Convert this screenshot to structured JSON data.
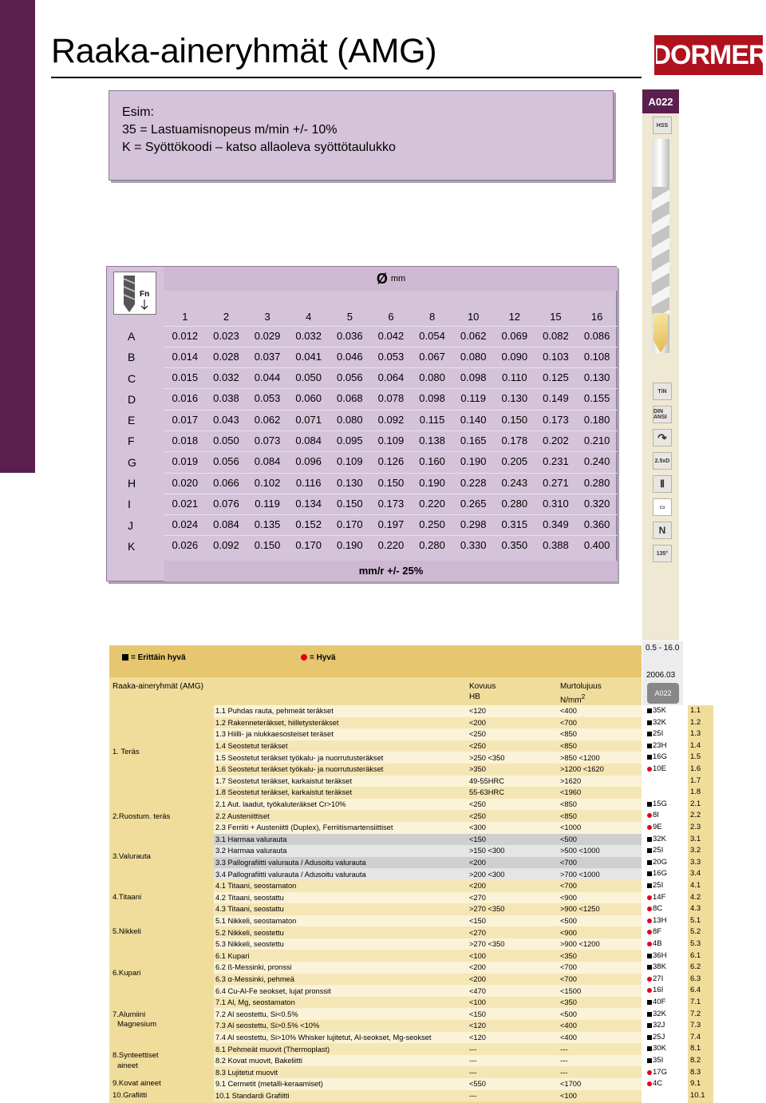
{
  "title": "Raaka-aineryhmät (AMG)",
  "brand": "DORMER",
  "product_code": "A022",
  "example": {
    "line1": "Esim:",
    "line2": "35 = Lastuamisnopeus m/min +/- 10%",
    "line3": "K = Syöttökoodi – katso allaoleva syöttötaulukko"
  },
  "side_icons": [
    "HSS",
    "TiN",
    "DIN ANSI",
    "2.5xD",
    "N",
    "135°"
  ],
  "feed_table": {
    "diameter_symbol": "Ø",
    "diameter_unit": "mm",
    "unit_label": "mm/r +/- 25%",
    "diameters": [
      "1",
      "2",
      "3",
      "4",
      "5",
      "6",
      "8",
      "10",
      "12",
      "15",
      "16"
    ],
    "rows": [
      {
        "code": "A",
        "values": [
          "0.012",
          "0.023",
          "0.029",
          "0.032",
          "0.036",
          "0.042",
          "0.054",
          "0.062",
          "0.069",
          "0.082",
          "0.086"
        ]
      },
      {
        "code": "B",
        "values": [
          "0.014",
          "0.028",
          "0.037",
          "0.041",
          "0.046",
          "0.053",
          "0.067",
          "0.080",
          "0.090",
          "0.103",
          "0.108"
        ]
      },
      {
        "code": "C",
        "values": [
          "0.015",
          "0.032",
          "0.044",
          "0.050",
          "0.056",
          "0.064",
          "0.080",
          "0.098",
          "0.110",
          "0.125",
          "0.130"
        ]
      },
      {
        "code": "D",
        "values": [
          "0.016",
          "0.038",
          "0.053",
          "0.060",
          "0.068",
          "0.078",
          "0.098",
          "0.119",
          "0.130",
          "0.149",
          "0.155"
        ]
      },
      {
        "code": "E",
        "values": [
          "0.017",
          "0.043",
          "0.062",
          "0.071",
          "0.080",
          "0.092",
          "0.115",
          "0.140",
          "0.150",
          "0.173",
          "0.180"
        ]
      },
      {
        "code": "F",
        "values": [
          "0.018",
          "0.050",
          "0.073",
          "0.084",
          "0.095",
          "0.109",
          "0.138",
          "0.165",
          "0.178",
          "0.202",
          "0.210"
        ]
      },
      {
        "code": "G",
        "values": [
          "0.019",
          "0.056",
          "0.084",
          "0.096",
          "0.109",
          "0.126",
          "0.160",
          "0.190",
          "0.205",
          "0.231",
          "0.240"
        ]
      },
      {
        "code": "H",
        "values": [
          "0.020",
          "0.066",
          "0.102",
          "0.116",
          "0.130",
          "0.150",
          "0.190",
          "0.228",
          "0.243",
          "0.271",
          "0.280"
        ]
      },
      {
        "code": "I",
        "values": [
          "0.021",
          "0.076",
          "0.119",
          "0.134",
          "0.150",
          "0.173",
          "0.220",
          "0.265",
          "0.280",
          "0.310",
          "0.320"
        ]
      },
      {
        "code": "J",
        "values": [
          "0.024",
          "0.084",
          "0.135",
          "0.152",
          "0.170",
          "0.197",
          "0.250",
          "0.298",
          "0.315",
          "0.349",
          "0.360"
        ]
      },
      {
        "code": "K",
        "values": [
          "0.026",
          "0.092",
          "0.150",
          "0.170",
          "0.190",
          "0.220",
          "0.280",
          "0.330",
          "0.350",
          "0.388",
          "0.400"
        ]
      }
    ]
  },
  "legend": {
    "very_good": "= Erittäin hyvä",
    "good": "= Hyvä"
  },
  "right_panel": {
    "range": "0.5 - 16.0",
    "date": "2006.03",
    "pic_label": "A022"
  },
  "materials_header": {
    "group": "Raaka-aineryhmät (AMG)",
    "hardness": "Kovuus",
    "hardness_unit": "HB",
    "strength": "Murtolujuus",
    "strength_unit": "N/mm",
    "strength_exp": "2"
  },
  "groups": [
    "1. Teräs",
    "2.Ruostum. teräs",
    "3.Valurauta",
    "4.Titaani",
    "5.Nikkeli",
    "6.Kupari",
    "7.Alumiini",
    "Magnesium",
    "8.Synteettiset",
    "aineet",
    "9.Kovat aineet",
    "10.Grafiitti"
  ],
  "materials": [
    {
      "name": "1.1 Puhdas rauta, pehmeät teräkset",
      "hb": "<120",
      "nmm": "<400",
      "mark": "sq",
      "code": "35K",
      "num": "1.1"
    },
    {
      "name": "1.2 Rakenneteräkset, hiilletysteräkset",
      "hb": "<200",
      "nmm": "<700",
      "mark": "sq",
      "code": "32K",
      "num": "1.2"
    },
    {
      "name": "1.3 Hiilli- ja niukkaesosteiset teräset",
      "hb": "<250",
      "nmm": "<850",
      "mark": "sq",
      "code": "25I",
      "num": "1.3"
    },
    {
      "name": "1.4 Seostetut teräkset",
      "hb": "<250",
      "nmm": "<850",
      "mark": "sq",
      "code": "23H",
      "num": "1.4"
    },
    {
      "name": "1.5 Seostetut teräkset työkalu- ja nuorrutusteräkset",
      "hb": ">250 <350",
      "nmm": ">850   <1200",
      "mark": "sq",
      "code": "16G",
      "num": "1.5"
    },
    {
      "name": "1.6 Seostetut teräkset työkalu- ja nuorrutusteräkset",
      "hb": ">350",
      "nmm": ">1200 <1620",
      "mark": "dot",
      "code": "10E",
      "num": "1.6"
    },
    {
      "name": "1.7 Seostetut teräkset, karkaistut teräkset",
      "hb": "49-55HRC",
      "nmm": ">1620",
      "mark": "",
      "code": "",
      "num": "1.7"
    },
    {
      "name": "1.8 Seostetut teräkset, karkaistut teräkset",
      "hb": "55-63HRC",
      "nmm": "<1960",
      "mark": "",
      "code": "",
      "num": "1.8"
    },
    {
      "name": "2.1 Aut. laadut, työkaluteräkset Cr>10%",
      "hb": "<250",
      "nmm": "<850",
      "mark": "sq",
      "code": "15G",
      "num": "2.1"
    },
    {
      "name": "2.2 Austeniittiset",
      "hb": "<250",
      "nmm": "<850",
      "mark": "dot",
      "code": "8I",
      "num": "2.2"
    },
    {
      "name": "2.3 Ferriiti + Austeniitti (Duplex), Ferriitismartensiittiset",
      "hb": "<300",
      "nmm": "<1000",
      "mark": "dot",
      "code": "9E",
      "num": "2.3"
    },
    {
      "name": "3.1 Harmaa valurauta",
      "hb": "<150",
      "nmm": "<500",
      "mark": "sq",
      "code": "32K",
      "num": "3.1"
    },
    {
      "name": "3.2 Harmaa valurauta",
      "hb": ">150 <300",
      "nmm": ">500 <1000",
      "mark": "sq",
      "code": "25I",
      "num": "3.2"
    },
    {
      "name": "3.3 Pallografiitti valurauta / Adusoitu valurauta",
      "hb": "<200",
      "nmm": "<700",
      "mark": "sq",
      "code": "20G",
      "num": "3.3"
    },
    {
      "name": "3.4 Pallografiitti valurauta / Adusoitu valurauta",
      "hb": ">200 <300",
      "nmm": ">700 <1000",
      "mark": "sq",
      "code": "16G",
      "num": "3.4"
    },
    {
      "name": "4.1 Titaani, seostamaton",
      "hb": "<200",
      "nmm": "<700",
      "mark": "sq",
      "code": "25I",
      "num": "4.1"
    },
    {
      "name": "4.2 Titaani, seostattu",
      "hb": "<270",
      "nmm": "<900",
      "mark": "dot",
      "code": "14F",
      "num": "4.2"
    },
    {
      "name": "4.3 Titaani, seostattu",
      "hb": ">270 <350",
      "nmm": ">900 <1250",
      "mark": "dot",
      "code": "8C",
      "num": "4.3"
    },
    {
      "name": "5.1 Nikkeli, seostamaton",
      "hb": "<150",
      "nmm": "<500",
      "mark": "dot",
      "code": "13H",
      "num": "5.1"
    },
    {
      "name": "5.2 Nikkeli, seostettu",
      "hb": "<270",
      "nmm": "<900",
      "mark": "dot",
      "code": "8F",
      "num": "5.2"
    },
    {
      "name": "5.3 Nikkeli, seostettu",
      "hb": ">270 <350",
      "nmm": ">900 <1200",
      "mark": "dot",
      "code": "4B",
      "num": "5.3"
    },
    {
      "name": "6.1 Kupari",
      "hb": "<100",
      "nmm": "<350",
      "mark": "sq",
      "code": "36H",
      "num": "6.1"
    },
    {
      "name": "6.2 ß-Messinki, pronssi",
      "hb": "<200",
      "nmm": "<700",
      "mark": "sq",
      "code": "38K",
      "num": "6.2"
    },
    {
      "name": "6.3 α-Messinki, pehmeä",
      "hb": "<200",
      "nmm": "<700",
      "mark": "dot",
      "code": "27I",
      "num": "6.3"
    },
    {
      "name": "6.4 Cu-Al-Fe seokset, lujat pronssit",
      "hb": "<470",
      "nmm": "<1500",
      "mark": "dot",
      "code": "16I",
      "num": "6.4"
    },
    {
      "name": "7.1 Al, Mg, seostamaton",
      "hb": "<100",
      "nmm": "<350",
      "mark": "sq",
      "code": "40F",
      "num": "7.1"
    },
    {
      "name": "7.2 Al seostettu, Si<0.5%",
      "hb": "<150",
      "nmm": "<500",
      "mark": "sq",
      "code": "32K",
      "num": "7.2"
    },
    {
      "name": "7.3 Al seostettu, Si>0.5% <10%",
      "hb": "<120",
      "nmm": "<400",
      "mark": "sq",
      "code": "32J",
      "num": "7.3"
    },
    {
      "name": "7.4 Al seostettu, Si>10% Whisker lujitetut, Al-seokset, Mg-seokset",
      "hb": "<120",
      "nmm": "<400",
      "mark": "sq",
      "code": "25J",
      "num": "7.4"
    },
    {
      "name": "8.1 Pehmeät muovit (Thermoplast)",
      "hb": "---",
      "nmm": "---",
      "mark": "sq",
      "code": "30K",
      "num": "8.1"
    },
    {
      "name": "8.2 Kovat muovit, Bakeliitti",
      "hb": "---",
      "nmm": "---",
      "mark": "sq",
      "code": "35I",
      "num": "8.2"
    },
    {
      "name": "8.3 Lujitetut muovit",
      "hb": "---",
      "nmm": "---",
      "mark": "dot",
      "code": "17G",
      "num": "8.3"
    },
    {
      "name": "9.1 Cermetit (metalli-keraamiset)",
      "hb": "<550",
      "nmm": "<1700",
      "mark": "dot",
      "code": "4C",
      "num": "9.1"
    },
    {
      "name": "10.1 Standardi Grafiitti",
      "hb": "---",
      "nmm": "<100",
      "mark": "",
      "code": "",
      "num": "10.1"
    }
  ]
}
